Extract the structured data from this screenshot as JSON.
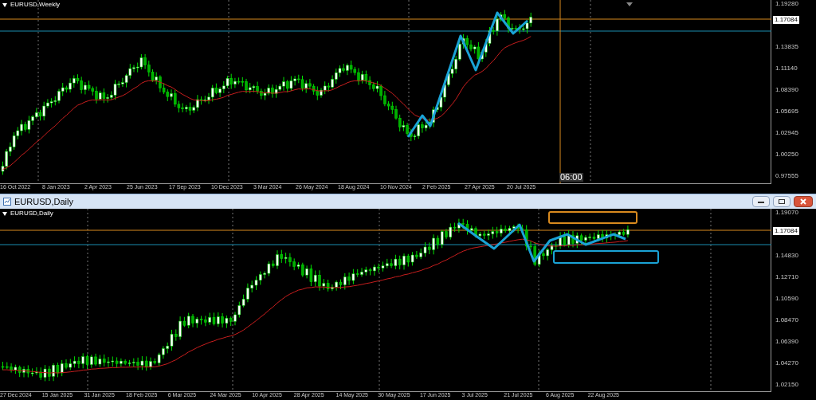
{
  "weekly_chart": {
    "title": "EURUSD,Weekly",
    "price_labels": [
      "1.19280",
      "1.13835",
      "1.11140",
      "1.08390",
      "1.05695",
      "1.02945",
      "1.00250",
      "0.97555"
    ],
    "price_tag": "1.17084",
    "crosshair_time": "06:00",
    "date_labels": [
      "16 Oct 2022",
      "8 Jan 2023",
      "2 Apr 2023",
      "25 Jun 2023",
      "17 Sep 2023",
      "10 Dec 2023",
      "3 Mar 2024",
      "26 May 2024",
      "18 Aug 2024",
      "10 Nov 2024",
      "2 Feb 2025",
      "27 Apr 2025",
      "20 Jul 2025"
    ]
  },
  "daily_window": {
    "title": "EURUSD,Daily",
    "chart": {
      "title": "EURUSD,Daily",
      "price_labels": [
        "1.19070",
        "1.14830",
        "1.12710",
        "1.10590",
        "1.08470",
        "1.06390",
        "1.04270",
        "1.02150"
      ],
      "price_tag": "1.17084",
      "date_labels": [
        "27 Dec 2024",
        "15 Jan 2025",
        "31 Jan 2025",
        "18 Feb 2025",
        "6 Mar 2025",
        "24 Mar 2025",
        "10 Apr 2025",
        "28 Apr 2025",
        "14 May 2025",
        "30 May 2025",
        "17 Jun 2025",
        "3 Jul 2025",
        "21 Jul 2025",
        "6 Aug 2025",
        "22 Aug 2025"
      ]
    }
  }
}
